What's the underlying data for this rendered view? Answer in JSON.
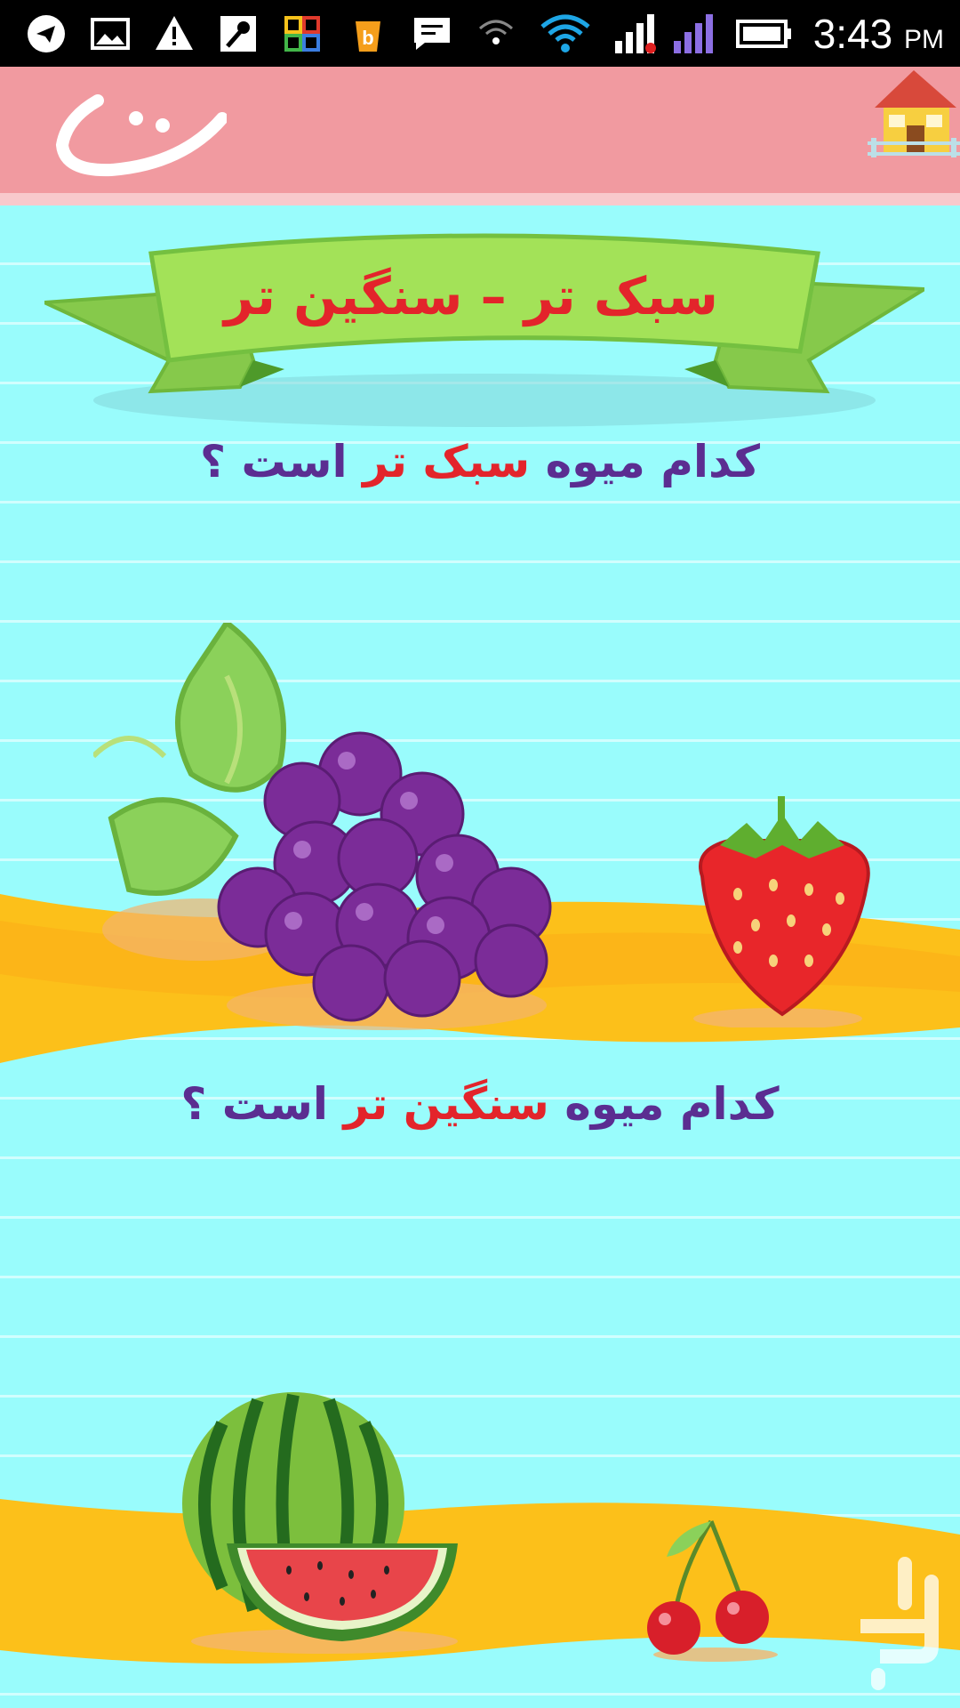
{
  "status_bar": {
    "time": "3:43",
    "ampm": "PM",
    "icons": [
      "telegram-icon",
      "gallery-icon",
      "warning-icon",
      "mic-icon",
      "grid-app-icon",
      "bazaar-icon",
      "message-icon",
      "wifi-weak-icon",
      "wifi-icon",
      "signal-icon",
      "signal-2-icon",
      "battery-icon"
    ]
  },
  "header": {
    "logo_icon": "brand-logo",
    "home_icon": "home-icon"
  },
  "banner": {
    "title": "سبک تر – سنگین تر"
  },
  "question1": {
    "prefix": "کدام میوه ",
    "highlight": "سبک تر",
    "suffix": " است ؟"
  },
  "question2": {
    "prefix": "کدام میوه ",
    "highlight": "سنگین تر",
    "suffix": " است ؟"
  },
  "fruits_row1": [
    "grapes-icon",
    "strawberry-icon"
  ],
  "fruits_row2": [
    "watermelon-icon",
    "cherries-icon"
  ],
  "colors": {
    "background": "#99fcfc",
    "appbar": "#f19aa0",
    "question_text": "#5b2d91",
    "highlight": "#e3242b",
    "ribbon": "#9de05a",
    "wave": "#fcc01a"
  }
}
